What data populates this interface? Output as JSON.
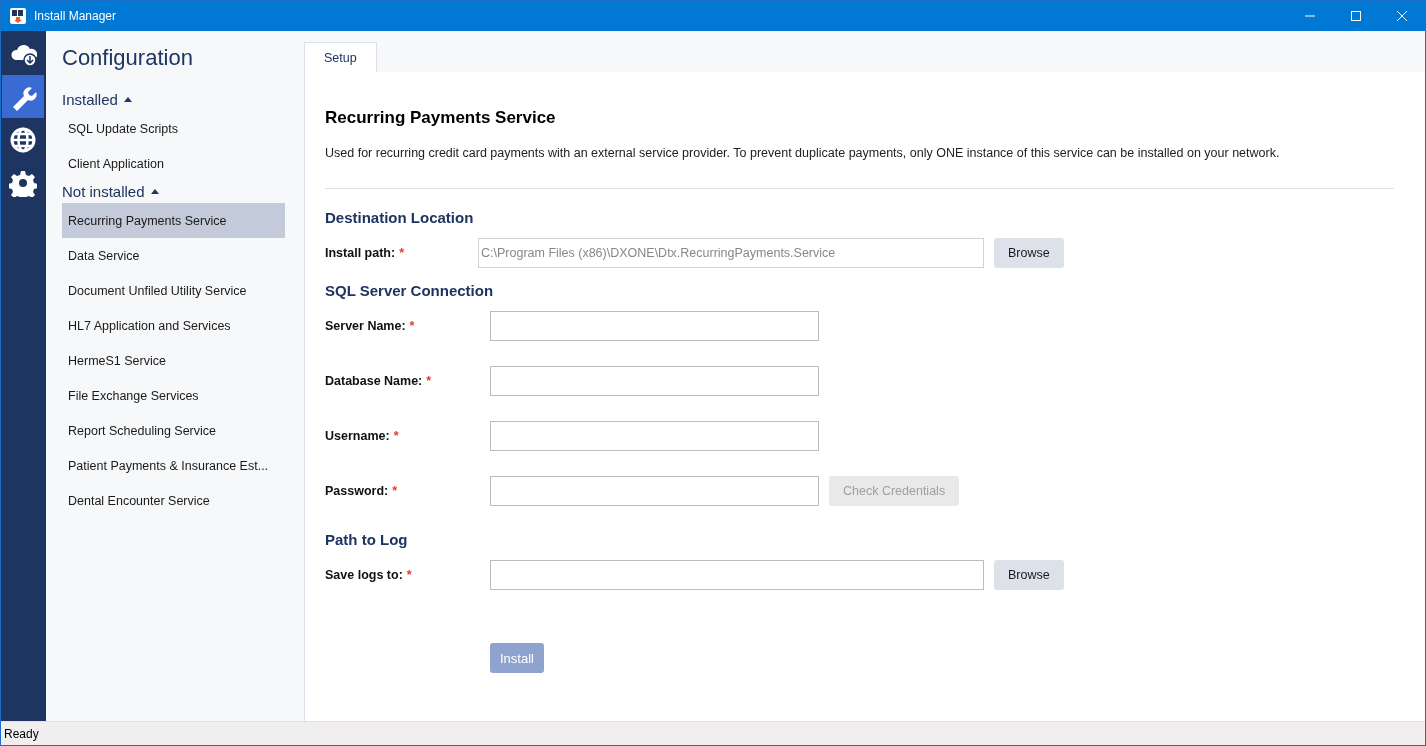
{
  "window": {
    "title": "Install Manager"
  },
  "rail": [
    {
      "kind": "cloud",
      "selected": false
    },
    {
      "kind": "wrench",
      "selected": true
    },
    {
      "kind": "globe",
      "selected": false
    },
    {
      "kind": "gear",
      "selected": false
    }
  ],
  "sidebar": {
    "title": "Configuration",
    "groups": [
      {
        "label": "Installed",
        "expanded": true,
        "items": [
          {
            "label": "SQL Update Scripts",
            "selected": false
          },
          {
            "label": "Client Application",
            "selected": false
          }
        ]
      },
      {
        "label": "Not installed",
        "expanded": true,
        "items": [
          {
            "label": "Recurring Payments Service",
            "selected": true
          },
          {
            "label": "Data Service",
            "selected": false
          },
          {
            "label": "Document Unfiled Utility Service",
            "selected": false
          },
          {
            "label": "HL7 Application and Services",
            "selected": false
          },
          {
            "label": "HermeS1 Service",
            "selected": false
          },
          {
            "label": "File Exchange Services",
            "selected": false
          },
          {
            "label": "Report Scheduling Service",
            "selected": false
          },
          {
            "label": "Patient Payments & Insurance Est...",
            "selected": false
          },
          {
            "label": "Dental Encounter Service",
            "selected": false
          }
        ]
      }
    ]
  },
  "tabs": [
    {
      "label": "Setup",
      "selected": true
    }
  ],
  "panel": {
    "title": "Recurring Payments Service",
    "description": "Used for recurring credit card payments with an external service provider. To prevent duplicate payments, only ONE instance of this service can be installed on your network.",
    "sections": [
      {
        "heading": "Destination Location",
        "fields": [
          {
            "label": "Install path:",
            "required_mark": "*",
            "value": "C:\\Program Files (x86)\\DXONE\\Dtx.RecurringPayments.Service",
            "kind": "wide",
            "disabled": true,
            "button": {
              "label": "Browse",
              "disabled": false
            }
          }
        ]
      },
      {
        "heading": "SQL Server Connection",
        "fields": [
          {
            "label": "Server Name:",
            "required_mark": "*",
            "kind": "short",
            "disabled": false
          },
          {
            "label": "Database Name:",
            "required_mark": "*",
            "kind": "short",
            "disabled": false
          },
          {
            "label": "Username:",
            "required_mark": "*",
            "kind": "short",
            "disabled": false
          },
          {
            "label": "Password:",
            "required_mark": "*",
            "kind": "short",
            "disabled": false,
            "button": {
              "label": "Check Credentials",
              "disabled": true
            }
          }
        ]
      },
      {
        "heading": "Path to Log",
        "fields": [
          {
            "label": "Save logs to:",
            "required_mark": "*",
            "kind": "wide",
            "disabled": false,
            "button": {
              "label": "Browse",
              "disabled": false
            }
          }
        ]
      }
    ],
    "install_button": {
      "label": "Install",
      "disabled": true
    }
  },
  "status_bar": {
    "text": "Ready"
  }
}
